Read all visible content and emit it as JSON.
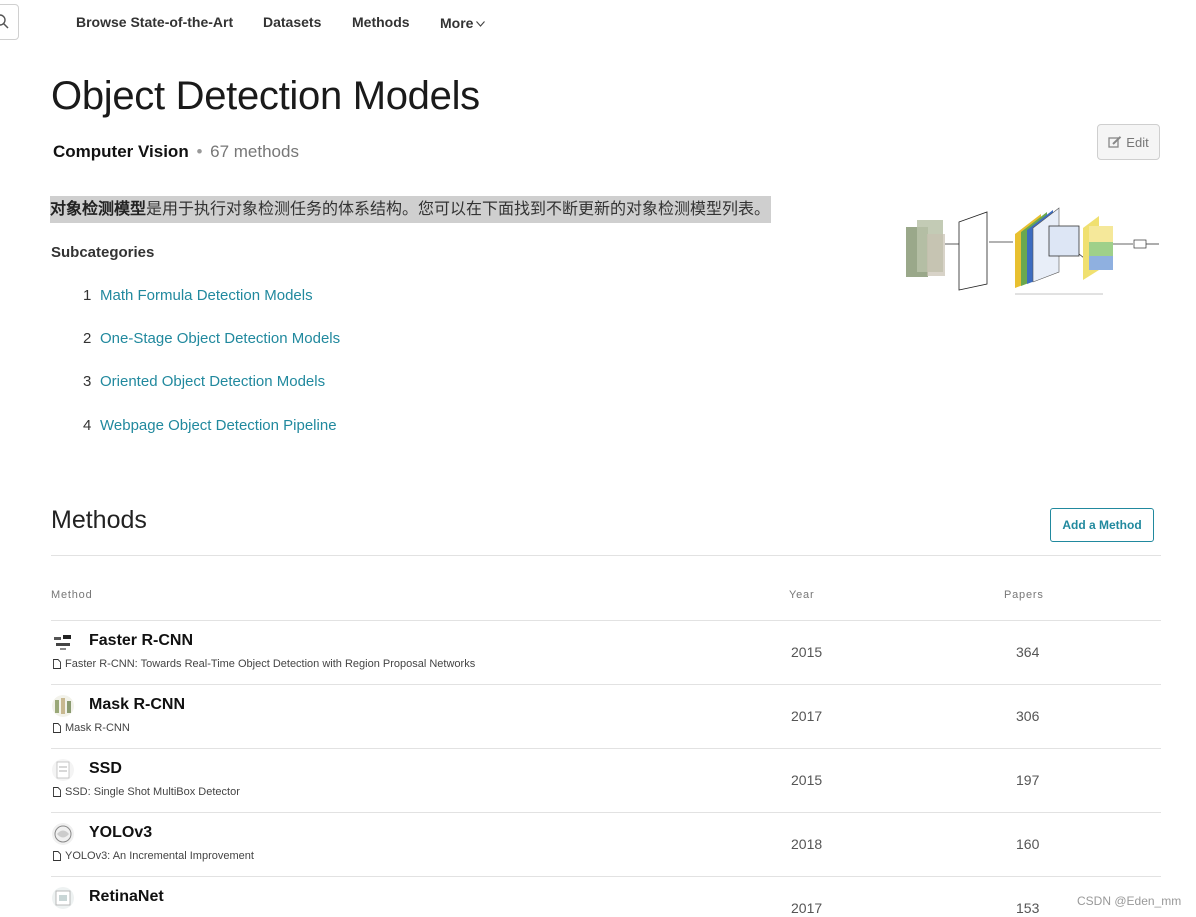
{
  "nav": {
    "items": [
      "Browse State-of-the-Art",
      "Datasets",
      "Methods",
      "More"
    ]
  },
  "header": {
    "title": "Object Detection Models",
    "area": "Computer Vision",
    "separator": "•",
    "method_count": "67 methods",
    "edit_label": "Edit"
  },
  "intro": {
    "bold": "对象检测模型",
    "text": "是用于执行对象检测任务的体系结构。您可以在下面找到不断更新的对象检测模型列表。"
  },
  "subcategories": {
    "title": "Subcategories",
    "items": [
      {
        "num": "1",
        "label": "Math Formula Detection Models"
      },
      {
        "num": "2",
        "label": "One-Stage Object Detection Models"
      },
      {
        "num": "3",
        "label": "Oriented Object Detection Models"
      },
      {
        "num": "4",
        "label": "Webpage Object Detection Pipeline"
      }
    ]
  },
  "methods": {
    "title": "Methods",
    "add_label": "Add a Method",
    "columns": [
      "Method",
      "Year",
      "Papers"
    ],
    "rows": [
      {
        "name": "Faster R-CNN",
        "paper": "Faster R-CNN: Towards Real-Time Object Detection with Region Proposal Networks",
        "year": "2015",
        "papers": "364"
      },
      {
        "name": "Mask R-CNN",
        "paper": "Mask R-CNN",
        "year": "2017",
        "papers": "306"
      },
      {
        "name": "SSD",
        "paper": "SSD: Single Shot MultiBox Detector",
        "year": "2015",
        "papers": "197"
      },
      {
        "name": "YOLOv3",
        "paper": "YOLOv3: An Incremental Improvement",
        "year": "2018",
        "papers": "160"
      },
      {
        "name": "RetinaNet",
        "paper": "",
        "year": "2017",
        "papers": "153"
      }
    ]
  },
  "watermark": "CSDN @Eden_mm",
  "colors": {
    "link": "#21899e",
    "highlight": "#cfcfcf"
  }
}
